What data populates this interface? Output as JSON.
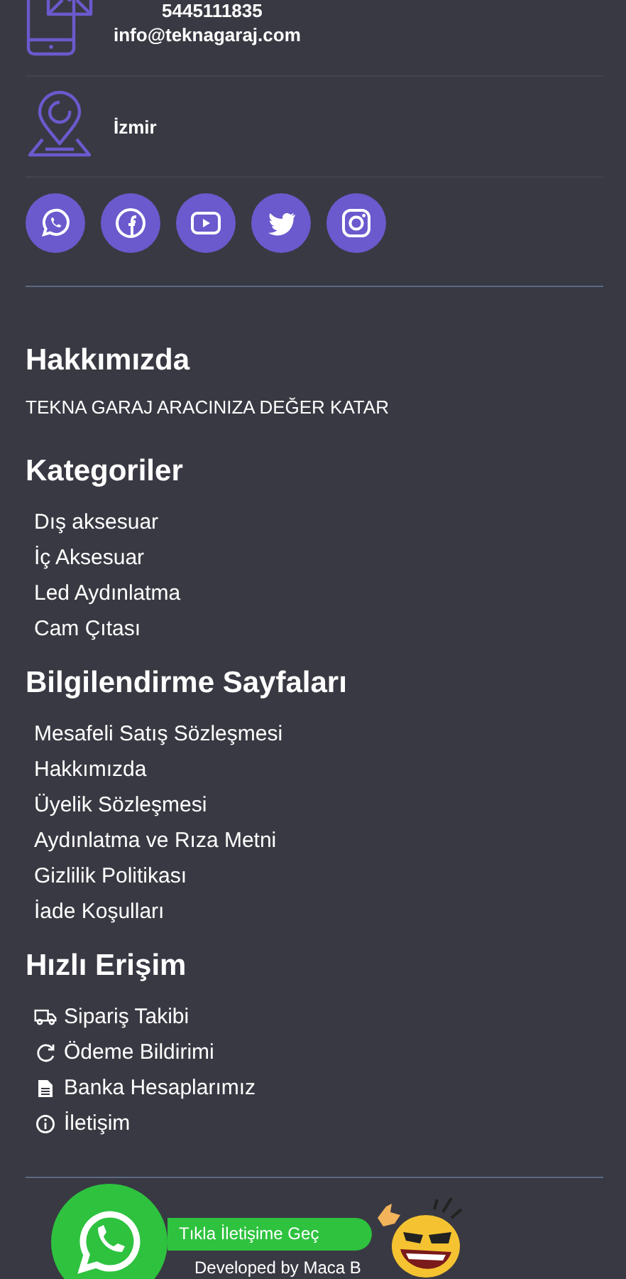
{
  "contacts": [
    {
      "kind": "mail",
      "lines": [
        "5445111835",
        "info@teknagaraj.com"
      ]
    },
    {
      "kind": "location",
      "lines": [
        "İzmir"
      ]
    }
  ],
  "social": [
    {
      "kind": "whatsapp"
    },
    {
      "kind": "facebook"
    },
    {
      "kind": "youtube"
    },
    {
      "kind": "twitter"
    },
    {
      "kind": "instagram"
    }
  ],
  "sections": [
    {
      "title": "Hakkımızda",
      "text": "TEKNA GARAJ ARACINIZA DEĞER KATAR"
    },
    {
      "title": "Kategoriler",
      "links": [
        {
          "label": "Dış aksesuar"
        },
        {
          "label": "İç Aksesuar"
        },
        {
          "label": "Led Aydınlatma"
        },
        {
          "label": "Cam Çıtası"
        }
      ]
    },
    {
      "title": "Bilgilendirme Sayfaları",
      "links": [
        {
          "label": "Mesafeli Satış Sözleşmesi"
        },
        {
          "label": "Hakkımızda"
        },
        {
          "label": "Üyelik Sözleşmesi"
        },
        {
          "label": "Aydınlatma ve Rıza Metni"
        },
        {
          "label": "Gizlilik Politikası"
        },
        {
          "label": "İade Koşulları"
        }
      ]
    },
    {
      "title": "Hızlı Erişim",
      "links": [
        {
          "label": "Sipariş Takibi",
          "kind": "truck"
        },
        {
          "label": "Ödeme Bildirimi",
          "kind": "refresh"
        },
        {
          "label": "Banka Hesaplarımız",
          "kind": "document"
        },
        {
          "label": "İletişim",
          "kind": "info"
        }
      ]
    }
  ],
  "whatsapp_button": {
    "label": "Tıkla İletişime Geç"
  },
  "credit": "Developed by Maca B"
}
